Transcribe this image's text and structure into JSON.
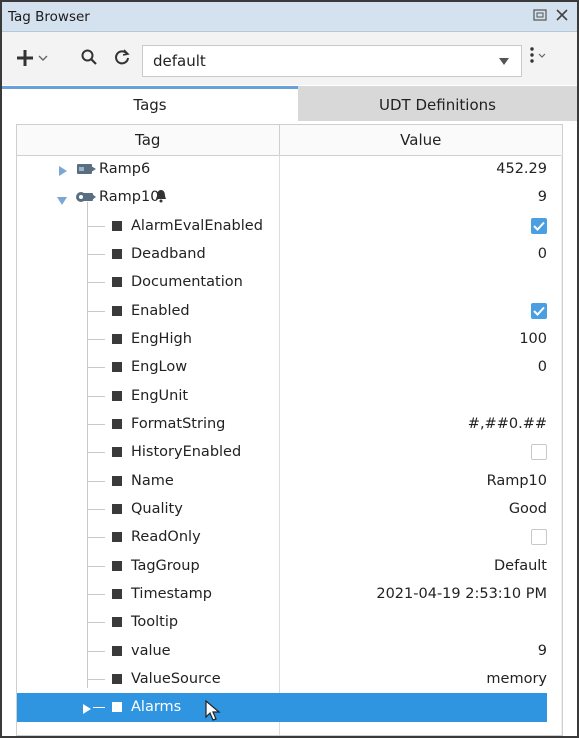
{
  "window": {
    "title": "Tag Browser"
  },
  "toolbar": {
    "provider_value": "default"
  },
  "tabs": [
    {
      "label": "Tags",
      "active": true
    },
    {
      "label": "UDT Definitions",
      "active": false
    }
  ],
  "table": {
    "columns": {
      "tag": "Tag",
      "value": "Value"
    },
    "rows": [
      {
        "label": "Ramp6",
        "value": "452.29"
      },
      {
        "label": "Ramp10",
        "value": "9"
      },
      {
        "label": "AlarmEvalEnabled",
        "value": "",
        "checked": true
      },
      {
        "label": "Deadband",
        "value": "0"
      },
      {
        "label": "Documentation",
        "value": ""
      },
      {
        "label": "Enabled",
        "value": "",
        "checked": true
      },
      {
        "label": "EngHigh",
        "value": "100"
      },
      {
        "label": "EngLow",
        "value": "0"
      },
      {
        "label": "EngUnit",
        "value": ""
      },
      {
        "label": "FormatString",
        "value": "#,##0.##"
      },
      {
        "label": "HistoryEnabled",
        "value": "",
        "checked": false
      },
      {
        "label": "Name",
        "value": "Ramp10"
      },
      {
        "label": "Quality",
        "value": "Good"
      },
      {
        "label": "ReadOnly",
        "value": "",
        "checked": false
      },
      {
        "label": "TagGroup",
        "value": "Default"
      },
      {
        "label": "Timestamp",
        "value": "2021-04-19 2:53:10 PM"
      },
      {
        "label": "Tooltip",
        "value": ""
      },
      {
        "label": "value",
        "value": "9"
      },
      {
        "label": "ValueSource",
        "value": "memory"
      },
      {
        "label": "Alarms",
        "value": "",
        "selected": true
      }
    ]
  },
  "icons": {
    "restore": "restore-icon",
    "close": "close-icon",
    "add": "add-icon",
    "search": "search-icon",
    "refresh": "refresh-icon",
    "menu": "kebab-menu-icon",
    "alarm": "bell-icon"
  },
  "colors": {
    "titlebar": "#d4e1ef",
    "tab_accent": "#6aa0d8",
    "selection": "#2f95e0",
    "checkbox_on": "#4a9ee2"
  }
}
